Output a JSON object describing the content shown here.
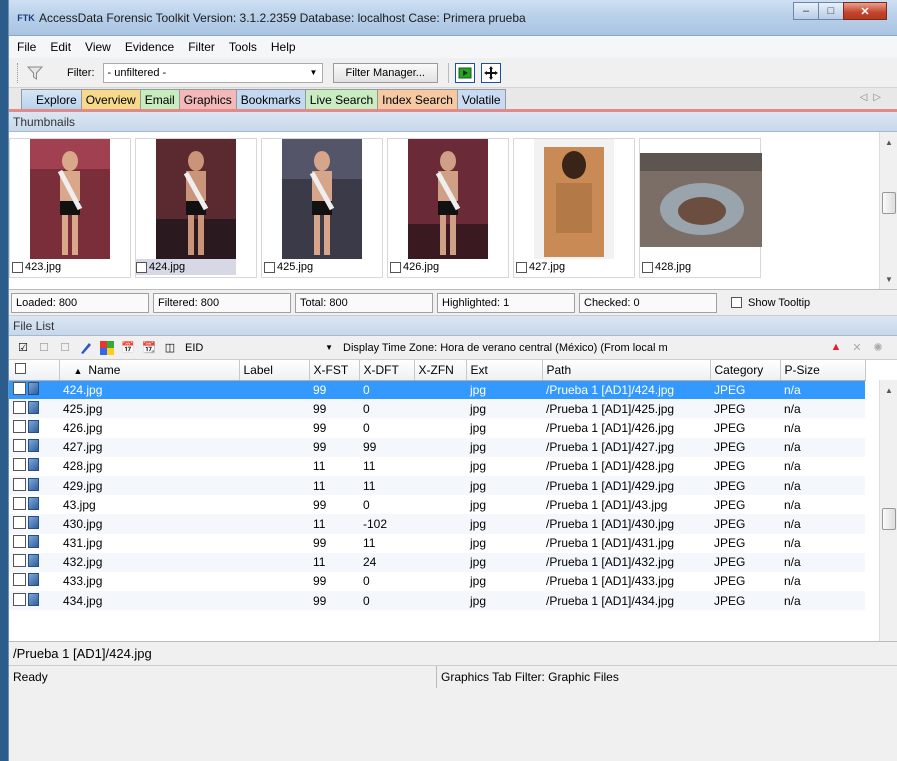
{
  "window": {
    "title": "AccessData Forensic Toolkit Version: 3.1.2.2359 Database: localhost Case: Primera prueba",
    "app_icon": "FTK",
    "controls": {
      "minimize": "minimize-icon",
      "maximize": "maximize-icon",
      "close": "close-icon"
    }
  },
  "menu": [
    {
      "label": "File"
    },
    {
      "label": "Edit"
    },
    {
      "label": "View"
    },
    {
      "label": "Evidence"
    },
    {
      "label": "Filter"
    },
    {
      "label": "Tools"
    },
    {
      "label": "Help"
    }
  ],
  "filterbar": {
    "label": "Filter:",
    "value": "- unfiltered -",
    "manager_button": "Filter Manager..."
  },
  "tabs": [
    {
      "label": "Explore",
      "class": "explore"
    },
    {
      "label": "Overview",
      "class": "overview"
    },
    {
      "label": "Email",
      "class": "email"
    },
    {
      "label": "Graphics",
      "class": "graphics",
      "active": true
    },
    {
      "label": "Bookmarks",
      "class": "bookmarks"
    },
    {
      "label": "Live Search",
      "class": "livesearch"
    },
    {
      "label": "Index Search",
      "class": "indexsearch"
    },
    {
      "label": "Volatile",
      "class": "volatile"
    }
  ],
  "thumbnails": {
    "header": "Thumbnails",
    "items": [
      {
        "label": "423.jpg"
      },
      {
        "label": "424.jpg",
        "selected": true
      },
      {
        "label": "425.jpg"
      },
      {
        "label": "426.jpg"
      },
      {
        "label": "427.jpg"
      },
      {
        "label": "428.jpg"
      }
    ]
  },
  "counts": {
    "loaded": "Loaded: 800",
    "filtered": "Filtered: 800",
    "total": "Total: 800",
    "highlighted": "Highlighted: 1",
    "checked": "Checked: 0",
    "show_tooltip": "Show Tooltip"
  },
  "file_list": {
    "header": "File List",
    "column_select": "EID",
    "timezone": "Display Time Zone: Hora de verano central (México)  (From local m",
    "columns": [
      "",
      "Name",
      "Label",
      "X-FST",
      "X-DFT",
      "X-ZFN",
      "Ext",
      "Path",
      "Category",
      "P-Size"
    ],
    "rows": [
      {
        "name": "424.jpg",
        "label": "",
        "xfst": "99",
        "xdft": "0",
        "xzfn": "",
        "ext": "jpg",
        "path": "/Prueba 1 [AD1]/424.jpg",
        "category": "JPEG",
        "psize": "n/a"
      },
      {
        "name": "425.jpg",
        "label": "",
        "xfst": "99",
        "xdft": "0",
        "xzfn": "",
        "ext": "jpg",
        "path": "/Prueba 1 [AD1]/425.jpg",
        "category": "JPEG",
        "psize": "n/a"
      },
      {
        "name": "426.jpg",
        "label": "",
        "xfst": "99",
        "xdft": "0",
        "xzfn": "",
        "ext": "jpg",
        "path": "/Prueba 1 [AD1]/426.jpg",
        "category": "JPEG",
        "psize": "n/a"
      },
      {
        "name": "427.jpg",
        "label": "",
        "xfst": "99",
        "xdft": "99",
        "xzfn": "",
        "ext": "jpg",
        "path": "/Prueba 1 [AD1]/427.jpg",
        "category": "JPEG",
        "psize": "n/a"
      },
      {
        "name": "428.jpg",
        "label": "",
        "xfst": "11",
        "xdft": "11",
        "xzfn": "",
        "ext": "jpg",
        "path": "/Prueba 1 [AD1]/428.jpg",
        "category": "JPEG",
        "psize": "n/a"
      },
      {
        "name": "429.jpg",
        "label": "",
        "xfst": "11",
        "xdft": "11",
        "xzfn": "",
        "ext": "jpg",
        "path": "/Prueba 1 [AD1]/429.jpg",
        "category": "JPEG",
        "psize": "n/a"
      },
      {
        "name": "43.jpg",
        "label": "",
        "xfst": "99",
        "xdft": "0",
        "xzfn": "",
        "ext": "jpg",
        "path": "/Prueba 1 [AD1]/43.jpg",
        "category": "JPEG",
        "psize": "n/a"
      },
      {
        "name": "430.jpg",
        "label": "",
        "xfst": "11",
        "xdft": "-102",
        "xzfn": "",
        "ext": "jpg",
        "path": "/Prueba 1 [AD1]/430.jpg",
        "category": "JPEG",
        "psize": "n/a"
      },
      {
        "name": "431.jpg",
        "label": "",
        "xfst": "99",
        "xdft": "11",
        "xzfn": "",
        "ext": "jpg",
        "path": "/Prueba 1 [AD1]/431.jpg",
        "category": "JPEG",
        "psize": "n/a"
      },
      {
        "name": "432.jpg",
        "label": "",
        "xfst": "11",
        "xdft": "24",
        "xzfn": "",
        "ext": "jpg",
        "path": "/Prueba 1 [AD1]/432.jpg",
        "category": "JPEG",
        "psize": "n/a"
      },
      {
        "name": "433.jpg",
        "label": "",
        "xfst": "99",
        "xdft": "0",
        "xzfn": "",
        "ext": "jpg",
        "path": "/Prueba 1 [AD1]/433.jpg",
        "category": "JPEG",
        "psize": "n/a"
      },
      {
        "name": "434.jpg",
        "label": "",
        "xfst": "99",
        "xdft": "0",
        "xzfn": "",
        "ext": "jpg",
        "path": "/Prueba 1 [AD1]/434.jpg",
        "category": "JPEG",
        "psize": "n/a"
      }
    ]
  },
  "path_bar": "/Prueba 1 [AD1]/424.jpg",
  "status": {
    "left": "Ready",
    "right": "Graphics Tab Filter: Graphic Files"
  },
  "colors": {
    "selection": "#3399ff",
    "graphics_tab": "#f3b9b9",
    "pane_header": "#c8d7ea"
  }
}
